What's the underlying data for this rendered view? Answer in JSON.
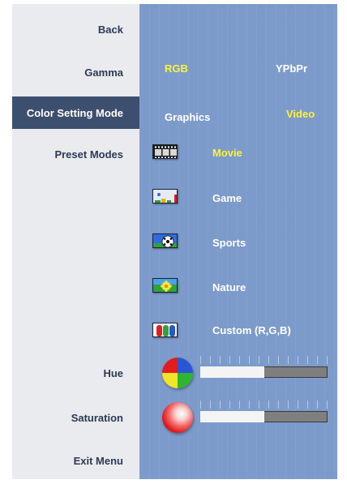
{
  "menu": {
    "items": [
      {
        "label": "Back"
      },
      {
        "label": "Gamma"
      },
      {
        "label": "Color Setting Mode"
      },
      {
        "label": "Preset Modes"
      },
      {
        "label": "Hue"
      },
      {
        "label": "Saturation"
      },
      {
        "label": "Exit Menu"
      }
    ],
    "selected": "Color Setting Mode"
  },
  "gamma": {
    "options": [
      "RGB",
      "YPbPr"
    ],
    "active": "RGB"
  },
  "color_setting_mode": {
    "options": [
      "Graphics",
      "Video"
    ],
    "active": "Video"
  },
  "preset_modes": {
    "items": [
      {
        "label": "Movie",
        "icon": "film-strip-icon"
      },
      {
        "label": "Game",
        "icon": "game-icon"
      },
      {
        "label": "Sports",
        "icon": "soccer-ball-icon"
      },
      {
        "label": "Nature",
        "icon": "flower-icon"
      },
      {
        "label": "Custom (R,G,B)",
        "icon": "rgb-bars-icon"
      }
    ],
    "active": "Movie"
  },
  "hue": {
    "level": 0.5,
    "icon": "color-wheel-icon"
  },
  "saturation": {
    "level": 0.5,
    "icon": "red-sphere-icon"
  },
  "colors": {
    "panel_blue": "#7c9bcb",
    "selected_bg": "#3d4f6e",
    "active_text": "#fff23a"
  }
}
